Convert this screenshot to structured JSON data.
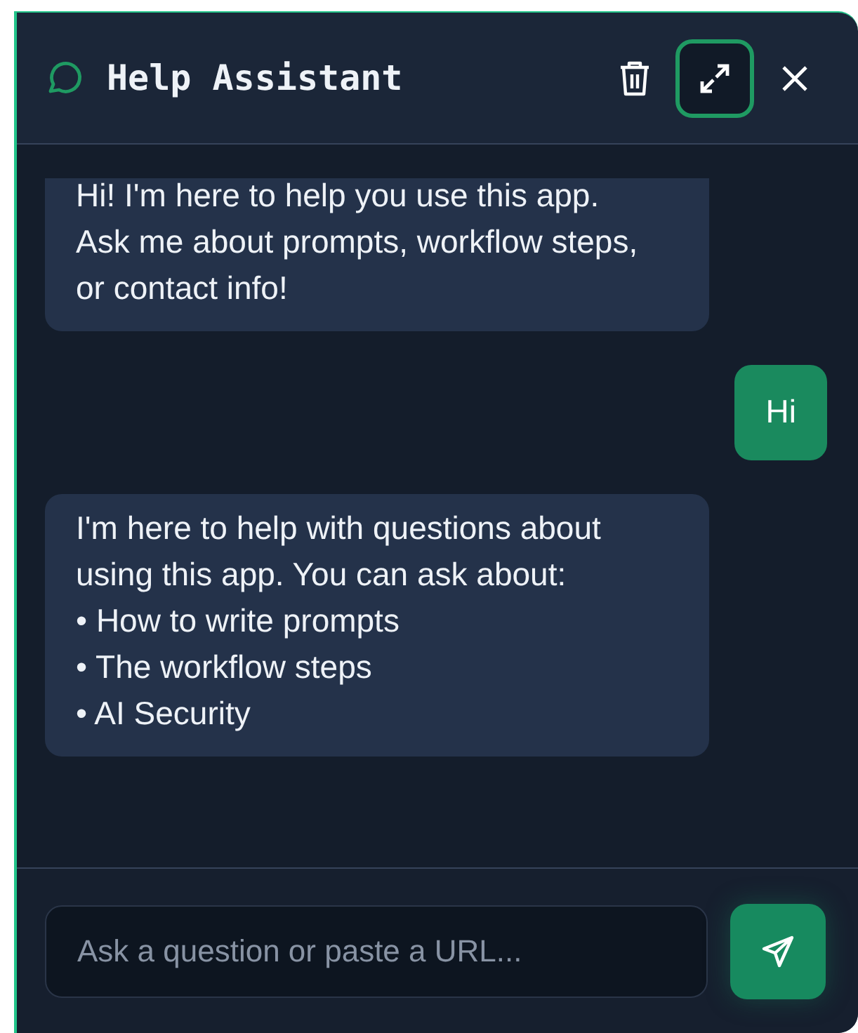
{
  "header": {
    "title": "Help Assistant",
    "expand_focused": true
  },
  "messages": [
    {
      "kind": "assistant",
      "text": "Hi! I'm here to help you use this app. Ask me about prompts, workflow steps, or contact info!"
    },
    {
      "kind": "user",
      "text": "Hi"
    },
    {
      "kind": "assistant",
      "text": "I'm here to help with questions about using this app. You can ask about:\n• How to write prompts\n• The workflow steps\n• AI Security"
    }
  ],
  "input": {
    "placeholder": "Ask a question or paste a URL..."
  }
}
